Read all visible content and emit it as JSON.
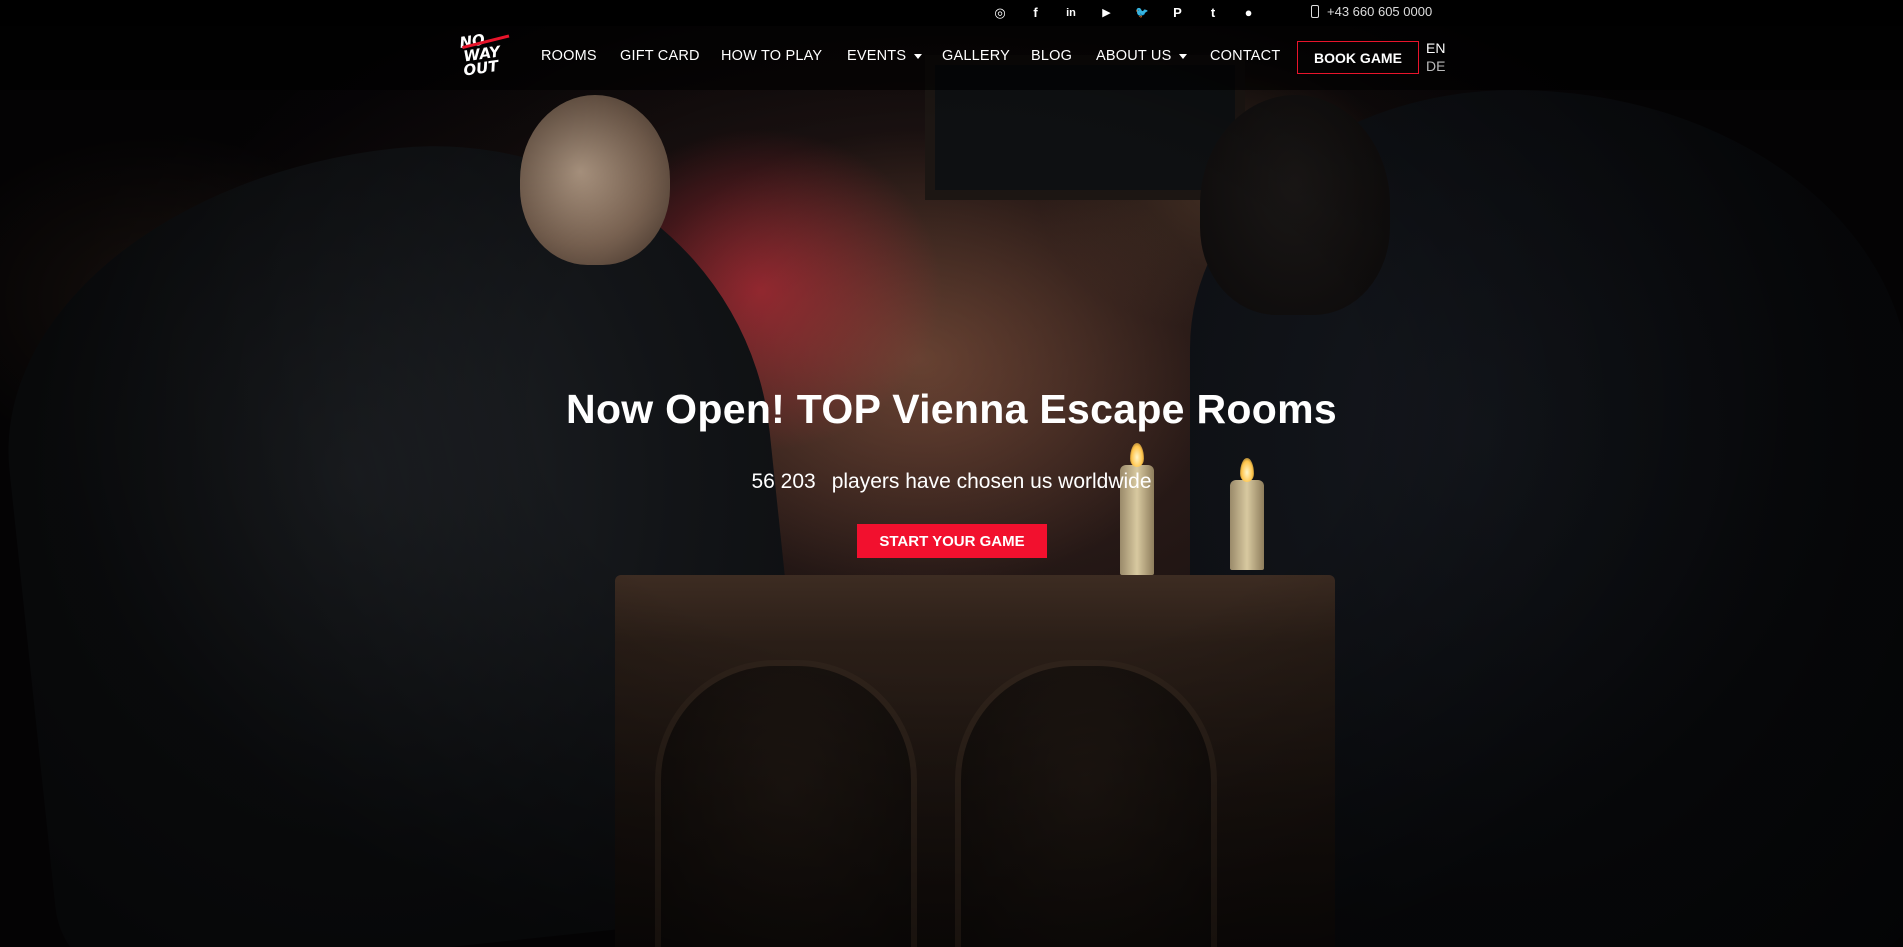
{
  "topbar": {
    "social_icons": [
      {
        "name": "instagram-icon",
        "glyph": "◎"
      },
      {
        "name": "facebook-icon",
        "glyph": "f"
      },
      {
        "name": "linkedin-icon",
        "glyph": "in"
      },
      {
        "name": "youtube-icon",
        "glyph": "▶"
      },
      {
        "name": "twitter-icon",
        "glyph": "🐦"
      },
      {
        "name": "pinterest-icon",
        "glyph": "P"
      },
      {
        "name": "tumblr-icon",
        "glyph": "t"
      },
      {
        "name": "reddit-icon",
        "glyph": "●"
      }
    ],
    "phone": "+43 660 605 0000"
  },
  "nav": {
    "logo_lines": [
      "NO",
      "WAY",
      "OUT"
    ],
    "items": [
      "ROOMS",
      "GIFT CARD",
      "HOW TO PLAY",
      "EVENTS",
      "GALLERY",
      "BLOG",
      "ABOUT US",
      "CONTACT"
    ],
    "book_label": "BOOK GAME",
    "lang_en": "EN",
    "lang_de": "DE"
  },
  "hero": {
    "title": "Now Open! TOP Vienna Escape Rooms",
    "players_count": "56 203",
    "players_text": "players have chosen us worldwide",
    "cta_label": "START YOUR GAME"
  },
  "colors": {
    "accent": "#f2102e",
    "topbar_bg": "#000000"
  }
}
